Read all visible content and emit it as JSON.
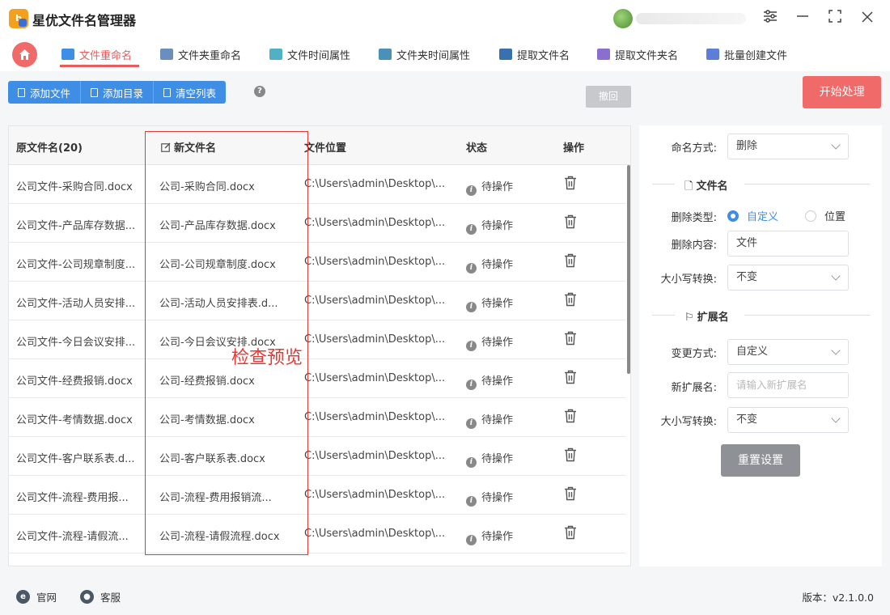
{
  "app": {
    "title": "星优文件名管理器"
  },
  "tabs": [
    {
      "label": "文件重命名",
      "color": "#3f8ee6"
    },
    {
      "label": "文件夹重命名",
      "color": "#6c8ebf"
    },
    {
      "label": "文件时间属性",
      "color": "#4fb0c6"
    },
    {
      "label": "文件夹时间属性",
      "color": "#4a90b8"
    },
    {
      "label": "提取文件名",
      "color": "#3a6fb0"
    },
    {
      "label": "提取文件夹名",
      "color": "#8a6fd1"
    },
    {
      "label": "批量创建文件",
      "color": "#5b7fd6"
    }
  ],
  "toolbar": {
    "add_file": "添加文件",
    "add_dir": "添加目录",
    "clear_list": "清空列表",
    "help": "?",
    "undo": "撤回",
    "start": "开始处理"
  },
  "table": {
    "headers": {
      "original": "原文件名(20)",
      "new": "新文件名",
      "location": "文件位置",
      "status": "状态",
      "action": "操作"
    },
    "rows": [
      {
        "original": "公司文件-采购合同.docx",
        "new": "公司-采购合同.docx",
        "location": "C:\\Users\\admin\\Desktop\\...",
        "status": "待操作"
      },
      {
        "original": "公司文件-产品库存数据...",
        "new": "公司-产品库存数据.docx",
        "location": "C:\\Users\\admin\\Desktop\\...",
        "status": "待操作"
      },
      {
        "original": "公司文件-公司规章制度...",
        "new": "公司-公司规章制度.docx",
        "location": "C:\\Users\\admin\\Desktop\\...",
        "status": "待操作"
      },
      {
        "original": "公司文件-活动人员安排...",
        "new": "公司-活动人员安排表.d...",
        "location": "C:\\Users\\admin\\Desktop\\...",
        "status": "待操作"
      },
      {
        "original": "公司文件-今日会议安排...",
        "new": "公司-今日会议安排.docx",
        "location": "C:\\Users\\admin\\Desktop\\...",
        "status": "待操作"
      },
      {
        "original": "公司文件-经费报销.docx",
        "new": "公司-经费报销.docx",
        "location": "C:\\Users\\admin\\Desktop\\...",
        "status": "待操作"
      },
      {
        "original": "公司文件-考情数据.docx",
        "new": "公司-考情数据.docx",
        "location": "C:\\Users\\admin\\Desktop\\...",
        "status": "待操作"
      },
      {
        "original": "公司文件-客户联系表.d...",
        "new": "公司-客户联系表.docx",
        "location": "C:\\Users\\admin\\Desktop\\...",
        "status": "待操作"
      },
      {
        "original": "公司文件-流程-费用报...",
        "new": "公司-流程-费用报销流...",
        "location": "C:\\Users\\admin\\Desktop\\...",
        "status": "待操作"
      },
      {
        "original": "公司文件-流程-请假流...",
        "new": "公司-流程-请假流程.docx",
        "location": "C:\\Users\\admin\\Desktop\\...",
        "status": "待操作"
      }
    ],
    "annotation": "检查预览"
  },
  "settings": {
    "naming_label": "命名方式:",
    "naming_value": "删除",
    "filename_section": "文件名",
    "delete_type_label": "删除类型:",
    "delete_type_options": [
      "自定义",
      "位置"
    ],
    "delete_content_label": "删除内容:",
    "delete_content_value": "文件",
    "case_label": "大小写转换:",
    "case_value": "不变",
    "ext_section": "扩展名",
    "change_label": "变更方式:",
    "change_value": "自定义",
    "new_ext_label": "新扩展名:",
    "new_ext_placeholder": "请输入新扩展名",
    "ext_case_label": "大小写转换:",
    "ext_case_value": "不变",
    "reset": "重置设置"
  },
  "footer": {
    "website": "官网",
    "support": "客服",
    "version": "版本：v2.1.0.0"
  }
}
